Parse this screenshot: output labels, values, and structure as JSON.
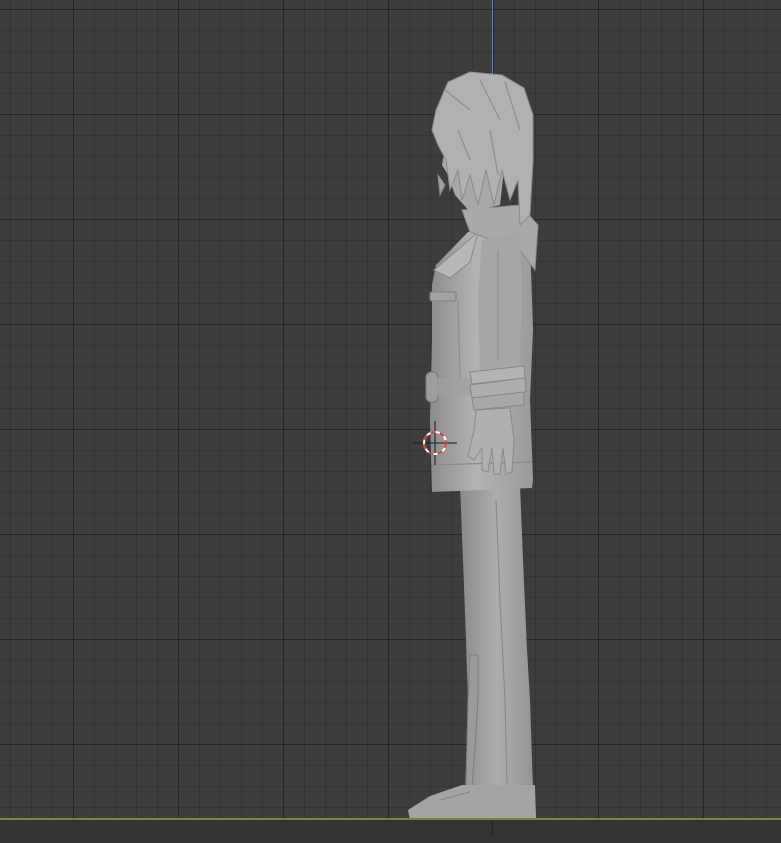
{
  "viewport": {
    "grid_color": "#323232",
    "background_color": "#3d3d3d",
    "z_axis_color": "#4f8ae0",
    "ground_axis_color": "#6f8a3c"
  },
  "model": {
    "icon": "character-sculpt-side-view",
    "color": "#a8a8a8"
  },
  "cursor": {
    "icon": "3d-cursor-icon",
    "colors": [
      "#d83a3a",
      "#ffffff"
    ]
  }
}
